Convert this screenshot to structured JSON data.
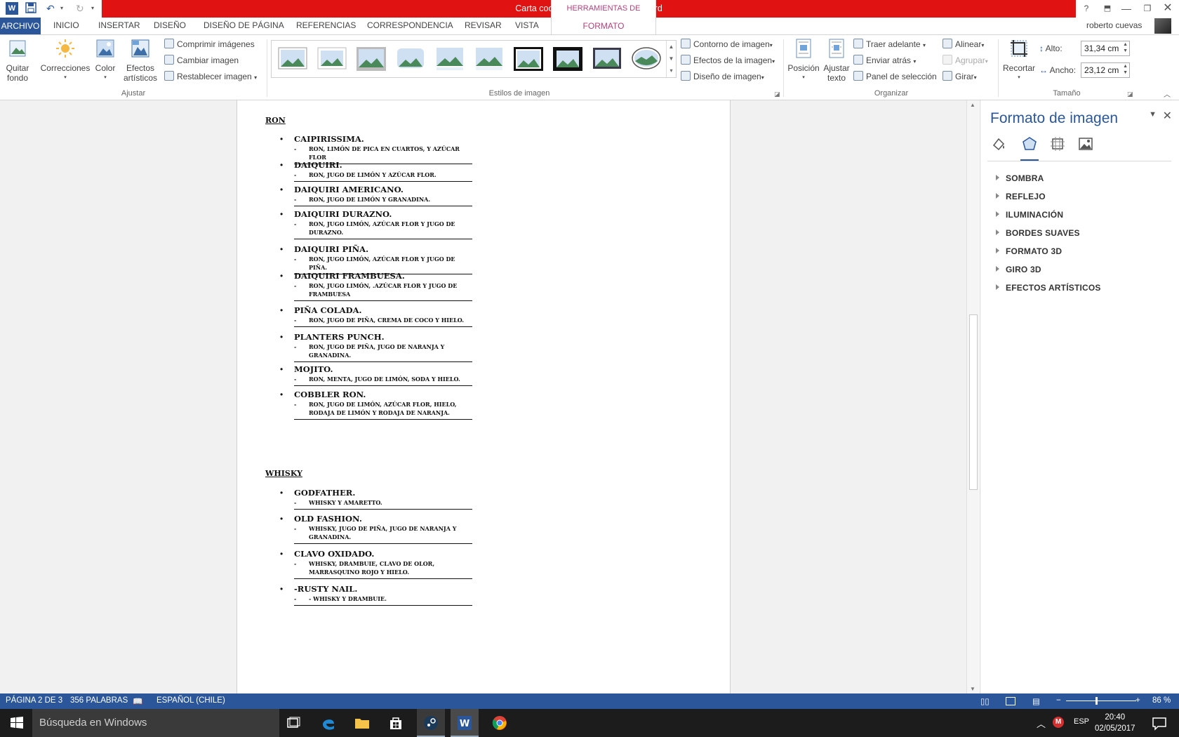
{
  "window": {
    "title": "Carta coctelera.docx -  Microsoft Word",
    "context_tab_header": "HERRAMIENTAS DE IMAGEN",
    "help": "?",
    "user": "roberto cuevas"
  },
  "tabs": [
    "ARCHIVO",
    "INICIO",
    "INSERTAR",
    "DISEÑO",
    "DISEÑO DE PÁGINA",
    "REFERENCIAS",
    "CORRESPONDENCIA",
    "REVISAR",
    "VISTA",
    "FORMATO"
  ],
  "ribbon": {
    "ajustar": {
      "label": "Ajustar",
      "quitar_fondo": [
        "Quitar",
        "fondo"
      ],
      "correcciones": "Correcciones",
      "color": "Color",
      "efectos": [
        "Efectos",
        "artísticos"
      ],
      "comprimir": "Comprimir imágenes",
      "cambiar": "Cambiar imagen",
      "restablecer": "Restablecer imagen"
    },
    "estilos": {
      "label": "Estilos de imagen",
      "contorno": "Contorno de imagen",
      "efectos": "Efectos de la imagen",
      "diseno": "Diseño de imagen"
    },
    "organizar": {
      "label": "Organizar",
      "posicion": "Posición",
      "ajustar_texto": [
        "Ajustar",
        "texto"
      ],
      "traer": "Traer adelante",
      "enviar": "Enviar atrás",
      "panel": "Panel de selección",
      "alinear": "Alinear",
      "agrupar": "Agrupar",
      "girar": "Girar"
    },
    "tamano": {
      "label": "Tamaño",
      "recortar": "Recortar",
      "alto_label": "Alto:",
      "alto_value": "31,34 cm",
      "ancho_label": "Ancho:",
      "ancho_value": "23,12 cm"
    }
  },
  "document": {
    "sections": [
      {
        "heading": "RON",
        "items": [
          {
            "name": "CAIPIRISSIMA.",
            "desc": "RON, LIMÓN DE PICA EN CUARTOS, Y AZÚCAR FLOR"
          },
          {
            "name": "DAIQUIRI.",
            "desc": "RON, JUGO DE LIMÓN Y AZÚCAR FLOR."
          },
          {
            "name": "DAIQUIRI AMERICANO.",
            "desc": "RON, JUGO DE LIMÓN Y GRANADINA."
          },
          {
            "name": "DAIQUIRI DURAZNO.",
            "desc": "RON, JUGO LIMÓN, AZÚCAR FLOR Y JUGO DE DURAZNO."
          },
          {
            "name": "DAIQUIRI PIÑA.",
            "desc": "RON, JUGO LIMÓN, AZÚCAR FLOR Y JUGO DE PIÑA."
          },
          {
            "name": "DAIQUIRI FRAMBUESA.",
            "desc": "RON, JUGO LIMÓN, .AZÚCAR FLOR Y JUGO DE FRAMBUESA"
          },
          {
            "name": "PIÑA COLADA.",
            "desc": "RON, JUGO DE PIÑA, CREMA DE COCO Y HIELO."
          },
          {
            "name": "PLANTERS PUNCH.",
            "desc": "RON, JUGO DE PIÑA, JUGO DE NARANJA Y GRANADINA."
          },
          {
            "name": "MOJITO.",
            "desc": "RON, MENTA, JUGO DE LIMÓN, SODA Y HIELO."
          },
          {
            "name": "COBBLER RON.",
            "desc": "RON, JUGO DE LIMÓN, AZÚCAR FLOR, HIELO, RODAJA DE LIMÓN Y RODAJA DE NARANJA."
          }
        ]
      },
      {
        "heading": "WHISKY",
        "items": [
          {
            "name": "GODFATHER.",
            "desc": "WHISKY Y AMARETTO."
          },
          {
            "name": "OLD FASHION.",
            "desc": "WHISKY, JUGO DE PIÑA, JUGO DE NARANJA Y GRANADINA."
          },
          {
            "name": "CLAVO  OXIDADO.",
            "desc": "WHISKY, DRAMBUIE, CLAVO DE OLOR, MARRASQUINO ROJO Y HIELO."
          },
          {
            "name": "-RUSTY NAIL.",
            "desc": "- WHISKY Y DRAMBUIE."
          }
        ]
      }
    ]
  },
  "pane": {
    "title": "Formato de imagen",
    "items": [
      "SOMBRA",
      "REFLEJO",
      "ILUMINACIÓN",
      "BORDES SUAVES",
      "FORMATO 3D",
      "GIRO 3D",
      "EFECTOS ARTÍSTICOS"
    ]
  },
  "status": {
    "page": "PÁGINA 2 DE 3",
    "words": "356 PALABRAS",
    "language": "ESPAÑOL (CHILE)",
    "zoom": "86 %",
    "zoom_level": 0.86
  },
  "taskbar": {
    "search": "Búsqueda en Windows",
    "lang": "ESP",
    "time": "20:40",
    "date": "02/05/2017"
  }
}
